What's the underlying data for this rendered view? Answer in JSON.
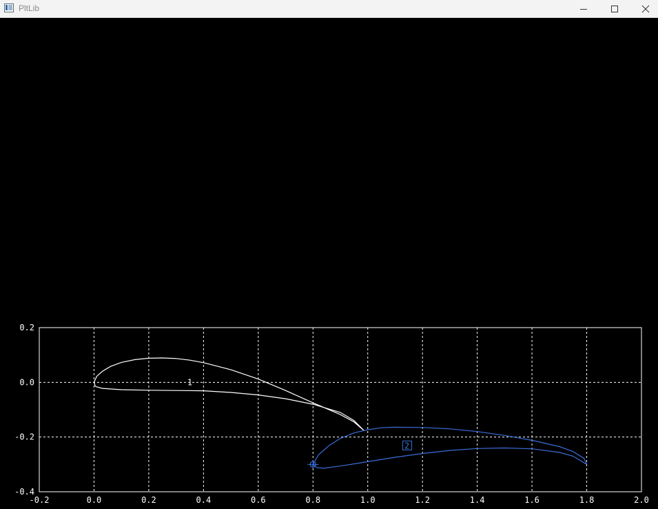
{
  "window": {
    "title": "PltLib",
    "icon": "app-window-icon",
    "controls": {
      "minimize_icon": "minimize-icon",
      "maximize_icon": "maximize-icon",
      "close_icon": "close-icon"
    }
  },
  "colors": {
    "background": "#000000",
    "axes": "#ffffff",
    "grid": "#ffffff",
    "element1": "#ffffff",
    "element2": "#3a6fd8"
  },
  "chart_data": {
    "type": "line",
    "xlim": [
      -0.2,
      2.0
    ],
    "ylim": [
      -0.4,
      0.2
    ],
    "xticks": [
      "-0.2",
      "0.0",
      "0.2",
      "0.4",
      "0.6",
      "0.8",
      "1.0",
      "1.2",
      "1.4",
      "1.6",
      "1.8",
      "2.0"
    ],
    "yticks": [
      "0.2",
      "0.0",
      "-0.2",
      "-0.4"
    ],
    "grid": true,
    "series": [
      {
        "label": "1",
        "label_pos": [
          0.35,
          0.0
        ],
        "label_boxed": false,
        "color": "#ffffff",
        "upper": [
          [
            0.0,
            0.0
          ],
          [
            0.01,
            0.022
          ],
          [
            0.03,
            0.04
          ],
          [
            0.06,
            0.058
          ],
          [
            0.1,
            0.073
          ],
          [
            0.15,
            0.083
          ],
          [
            0.2,
            0.088
          ],
          [
            0.25,
            0.089
          ],
          [
            0.3,
            0.087
          ],
          [
            0.35,
            0.081
          ],
          [
            0.4,
            0.072
          ],
          [
            0.5,
            0.046
          ],
          [
            0.6,
            0.012
          ],
          [
            0.7,
            -0.03
          ],
          [
            0.8,
            -0.075
          ],
          [
            0.9,
            -0.118
          ],
          [
            0.95,
            -0.145
          ],
          [
            0.985,
            -0.175
          ]
        ],
        "lower": [
          [
            0.0,
            0.0
          ],
          [
            0.005,
            -0.015
          ],
          [
            0.03,
            -0.022
          ],
          [
            0.1,
            -0.027
          ],
          [
            0.2,
            -0.029
          ],
          [
            0.3,
            -0.03
          ],
          [
            0.4,
            -0.031
          ],
          [
            0.5,
            -0.037
          ],
          [
            0.6,
            -0.046
          ],
          [
            0.7,
            -0.06
          ],
          [
            0.8,
            -0.08
          ],
          [
            0.9,
            -0.11
          ],
          [
            0.95,
            -0.14
          ],
          [
            0.985,
            -0.175
          ]
        ]
      },
      {
        "label": "2",
        "label_pos": [
          1.143,
          -0.232
        ],
        "label_boxed": true,
        "color": "#3a6fd8",
        "upper": [
          [
            0.8,
            -0.3
          ],
          [
            0.82,
            -0.265
          ],
          [
            0.86,
            -0.23
          ],
          [
            0.9,
            -0.205
          ],
          [
            0.95,
            -0.185
          ],
          [
            1.0,
            -0.173
          ],
          [
            1.05,
            -0.166
          ],
          [
            1.1,
            -0.164
          ],
          [
            1.2,
            -0.165
          ],
          [
            1.3,
            -0.17
          ],
          [
            1.4,
            -0.18
          ],
          [
            1.5,
            -0.194
          ],
          [
            1.6,
            -0.212
          ],
          [
            1.7,
            -0.235
          ],
          [
            1.75,
            -0.253
          ],
          [
            1.79,
            -0.278
          ],
          [
            1.8,
            -0.3
          ]
        ],
        "lower": [
          [
            0.8,
            -0.3
          ],
          [
            0.815,
            -0.312
          ],
          [
            0.84,
            -0.314
          ],
          [
            0.9,
            -0.306
          ],
          [
            1.0,
            -0.29
          ],
          [
            1.1,
            -0.274
          ],
          [
            1.2,
            -0.26
          ],
          [
            1.3,
            -0.249
          ],
          [
            1.4,
            -0.242
          ],
          [
            1.5,
            -0.24
          ],
          [
            1.6,
            -0.243
          ],
          [
            1.7,
            -0.256
          ],
          [
            1.75,
            -0.27
          ],
          [
            1.8,
            -0.3
          ]
        ],
        "marker": [
          0.8,
          -0.3
        ]
      }
    ]
  }
}
